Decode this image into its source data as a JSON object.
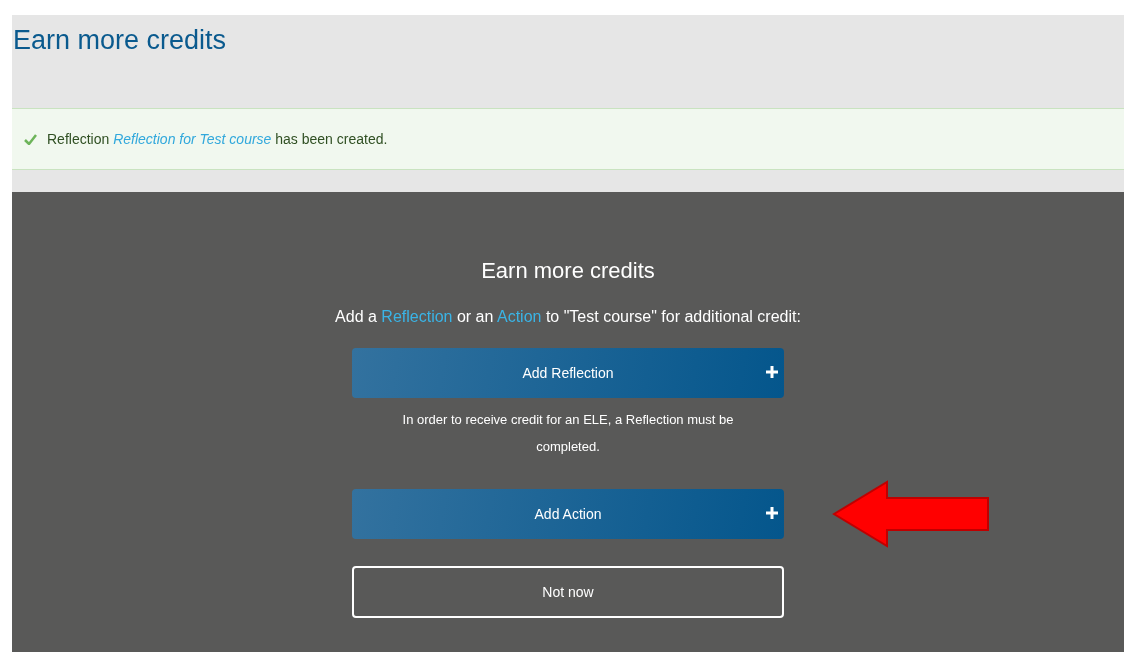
{
  "page_title": "Earn more credits",
  "alert": {
    "kind": "success",
    "parts": [
      {
        "kind": "text",
        "text": "Reflection "
      },
      {
        "kind": "link",
        "text": "Reflection for Test course"
      },
      {
        "kind": "text",
        "text": " has been created."
      }
    ]
  },
  "panel": {
    "title": "Earn more credits",
    "intro": [
      {
        "kind": "text",
        "text": "Add a "
      },
      {
        "kind": "link",
        "text": "Reflection"
      },
      {
        "kind": "text",
        "text": " or an "
      },
      {
        "kind": "link",
        "text": "Action"
      },
      {
        "kind": "text",
        "text": " to \"Test course\" for additional credit:"
      }
    ],
    "actions": [
      {
        "kind": "primary",
        "label": "Add Reflection",
        "note": "In order to receive credit for an ELE, a Reflection must be completed.",
        "highlighted": false
      },
      {
        "kind": "primary",
        "label": "Add Action",
        "highlighted": true
      },
      {
        "kind": "outline",
        "label": "Not now",
        "highlighted": false
      }
    ]
  }
}
